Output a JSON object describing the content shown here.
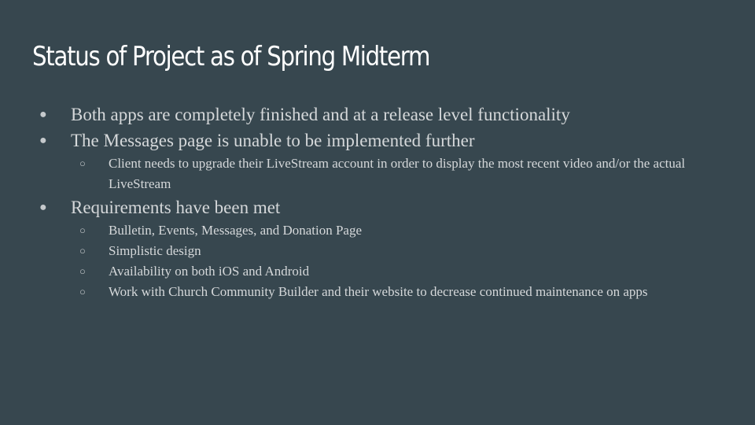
{
  "slide": {
    "title": "Status of Project as of Spring Midterm",
    "bullets": [
      {
        "level": 1,
        "text": "Both apps are completely finished and at a release level functionality"
      },
      {
        "level": 1,
        "text": "The Messages page is unable to be implemented further"
      },
      {
        "level": 2,
        "text": "Client needs to upgrade their LiveStream account in order to display the most recent video and/or the actual LiveStream"
      },
      {
        "level": 1,
        "text": "Requirements have been met"
      },
      {
        "level": 2,
        "text": "Bulletin, Events, Messages, and Donation Page"
      },
      {
        "level": 2,
        "text": "Simplistic design"
      },
      {
        "level": 2,
        "text": "Availability on both iOS and Android"
      },
      {
        "level": 2,
        "text": "Work with Church Community Builder and their website to decrease continued maintenance on apps"
      }
    ]
  },
  "colors": {
    "background": "#37474f",
    "title": "#ffffff",
    "body_text": "#d5d8da"
  },
  "icons": {
    "level1_bullet": "filled-circle",
    "level2_bullet": "hollow-circle"
  }
}
